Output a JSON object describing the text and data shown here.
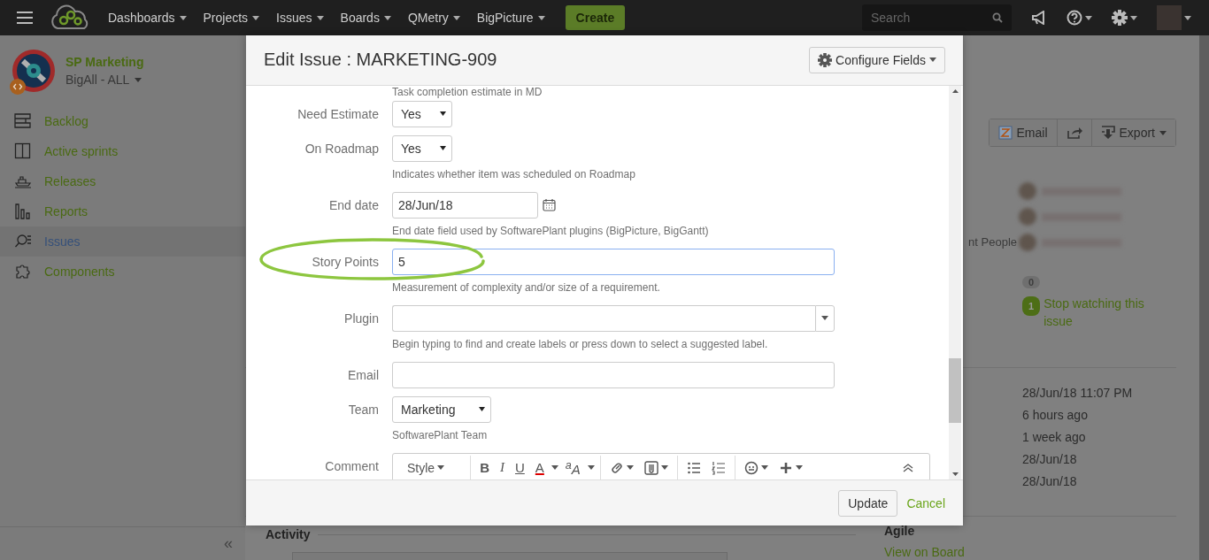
{
  "nav": {
    "menu_items": [
      {
        "label": "Dashboards"
      },
      {
        "label": "Projects"
      },
      {
        "label": "Issues"
      },
      {
        "label": "Boards"
      },
      {
        "label": "QMetry"
      },
      {
        "label": "BigPicture"
      }
    ],
    "create": "Create",
    "search_placeholder": "Search"
  },
  "sidebar": {
    "project": "SP Marketing",
    "board": "BigAll - ALL",
    "items": [
      {
        "label": "Backlog",
        "selected": false
      },
      {
        "label": "Active sprints",
        "selected": false
      },
      {
        "label": "Releases",
        "selected": false
      },
      {
        "label": "Reports",
        "selected": false
      },
      {
        "label": "Issues",
        "selected": true
      },
      {
        "label": "Components",
        "selected": false
      }
    ],
    "collapse": "«"
  },
  "page": {
    "actions": [
      "Email",
      "Export"
    ],
    "people_label": "nt People",
    "votes": "0",
    "watchers": "1",
    "watch_link": "Stop watching this issue",
    "dates": [
      "28/Jun/18 11:07 PM",
      "6 hours ago",
      "1 week ago",
      "28/Jun/18",
      "28/Jun/18"
    ],
    "activity": "Activity",
    "agile": "Agile",
    "agile_link": "View on Board"
  },
  "dialog": {
    "title": "Edit Issue : MARKETING-909",
    "configure": "Configure Fields",
    "top_note": "Task completion estimate in MD",
    "fields": [
      {
        "kind": "select",
        "label": "Need Estimate",
        "value": "Yes",
        "focused": false
      },
      {
        "kind": "select",
        "label": "On Roadmap",
        "value": "Yes",
        "focused": false,
        "description": "Indicates whether item was scheduled on Roadmap"
      },
      {
        "kind": "date",
        "label": "End date",
        "value": "28/Jun/18",
        "focused": false,
        "description": "End date field used by SoftwarePlant plugins (BigPicture, BigGantt)"
      },
      {
        "kind": "text",
        "label": "Story Points",
        "value": "5",
        "focused": true,
        "description": "Measurement of complexity and/or size of a requirement."
      },
      {
        "kind": "combo",
        "label": "Plugin",
        "focused": false,
        "description": "Begin typing to find and create labels or press down to select a suggested label."
      },
      {
        "kind": "text",
        "label": "Email",
        "focused": false
      },
      {
        "kind": "select",
        "label": "Team",
        "value": "Marketing",
        "focused": false,
        "description": "SoftwarePlant Team"
      },
      {
        "kind": "editor",
        "label": "Comment",
        "focused": false
      }
    ],
    "editor_toolbar": [
      {
        "kind": "menu",
        "label": "Style"
      },
      {
        "kind": "bold",
        "label": "B"
      },
      {
        "kind": "italic",
        "label": "I"
      },
      {
        "kind": "underline",
        "label": "U"
      },
      {
        "kind": "textcolor",
        "label": "A"
      },
      {
        "kind": "effects",
        "label": "$^{a}$A"
      }
    ],
    "update": "Update",
    "cancel": "Cancel"
  }
}
